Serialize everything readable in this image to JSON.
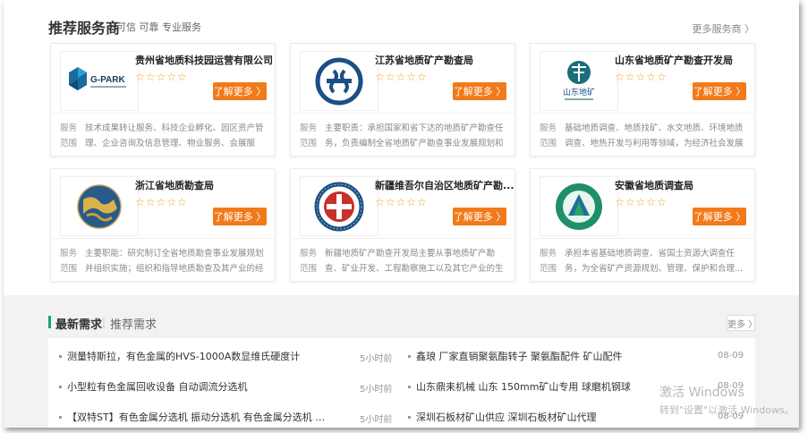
{
  "header": {
    "title": "推荐服务商",
    "subtitle": "可信 可靠 专业服务",
    "more": "更多服务商 〉"
  },
  "common": {
    "stars": "☆☆☆☆☆",
    "button_label": "了解更多 〉",
    "scope_label": "服务\n范围"
  },
  "providers": [
    {
      "name": "贵州省地质科技园运营有限公司",
      "logo_text": "G-PARK",
      "scope": "技术成果转让服务、科技企业孵化、园区资产管理、企业咨询及信息管理、物业服务、会展服务..."
    },
    {
      "name": "江苏省地质矿产勘查局",
      "logo_text": "",
      "scope": "主要职责：承担国家和省下达的地质矿产勘查任务，负责编制全省地质矿产勘查事业发展规划和有关技术..."
    },
    {
      "name": "山东省地质矿产勘查开发局",
      "logo_text": "山东地矿",
      "scope": "基础地质调查、地质找矿、水文地质、环境地质调查、地热开发与利用等领域，为经济社会发展提供..."
    },
    {
      "name": "浙江省地质勘查局",
      "logo_text": "",
      "scope": "主要职能：研究制订全省地质勘查事业发展规划并组织实施；组织和指导地质勘查及其产业的经营..."
    },
    {
      "name": "新疆维吾尔自治区地质矿产勘...",
      "logo_text": "",
      "scope": "新疆地质矿产勘查开发局主要从事地质矿产勘查、矿业开发、工程勘察施工以及其它产业的生产经..."
    },
    {
      "name": "安徽省地质调查局",
      "logo_text": "",
      "scope": "承担本省基础地质调查、省国土资源大调查任务，为全省矿产资源规划、管理、保护和合理..."
    }
  ],
  "requests": {
    "tab_latest": "最新需求",
    "tab_recommended": "推荐需求",
    "more": "更多 〉",
    "left": [
      {
        "title": "测量特斯拉，有色金属的HVS-1000A数显维氏硬度计",
        "time": "5小时前"
      },
      {
        "title": "小型粒有色金属回收设备 自动调流分选机",
        "time": "5小时前"
      },
      {
        "title": "【双特ST】有色金属分选机 振动分选机 有色金属分选机 涡流机 ...",
        "time": "5小时前"
      }
    ],
    "right": [
      {
        "title": "鑫琅 厂家直销聚氨酯转子 聚氨酯配件 矿山配件",
        "time": "08-09"
      },
      {
        "title": "山东鼎耒机械 山东 150mm矿山专用 球磨机钢球",
        "time": "08-09"
      },
      {
        "title": "深圳石板材矿山供应 深圳石板材矿山代理",
        "time": "08-09"
      }
    ]
  },
  "watermark": {
    "line1": "激活 Windows",
    "line2": "转到\"设置\"以激活 Windows。"
  }
}
